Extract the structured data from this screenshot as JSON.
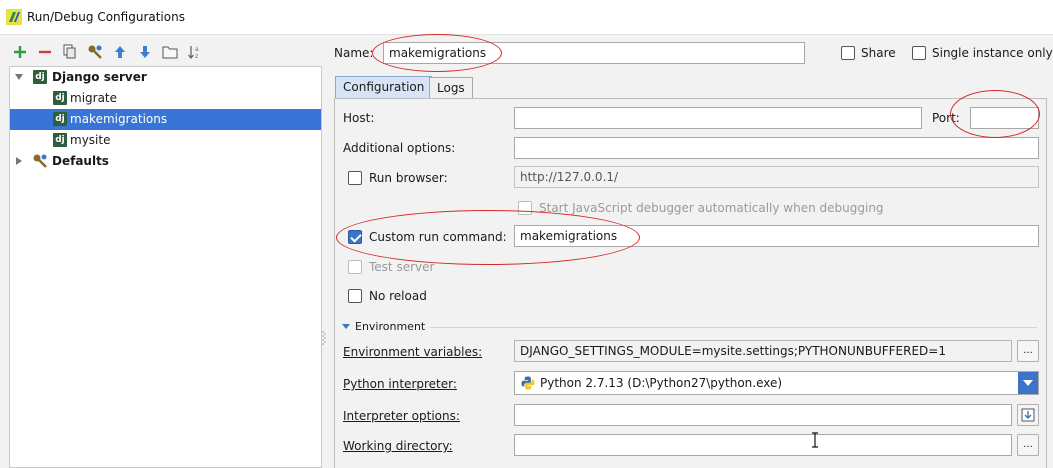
{
  "window": {
    "title": "Run/Debug Configurations"
  },
  "toolbar": {
    "buttons": [
      {
        "name": "add-icon",
        "glyph": "+"
      },
      {
        "name": "remove-icon",
        "glyph": "−"
      },
      {
        "name": "copy-icon"
      },
      {
        "name": "wrench-icon"
      },
      {
        "name": "move-up-icon"
      },
      {
        "name": "move-down-icon"
      },
      {
        "name": "folder-icon"
      },
      {
        "name": "sort-icon"
      }
    ]
  },
  "tree": {
    "group": "Django server",
    "items": [
      "migrate",
      "makemigrations",
      "mysite"
    ],
    "selected": "makemigrations",
    "defaults": "Defaults"
  },
  "header": {
    "name_label": "Name:",
    "name_value": "makemigrations",
    "share_label": "Share",
    "single_instance_label": "Single instance only"
  },
  "tabs": [
    "Configuration",
    "Logs"
  ],
  "config": {
    "host_label": "Host:",
    "host_value": "",
    "port_label": "Port:",
    "port_value": "",
    "additional_options_label": "Additional options:",
    "additional_options_value": "",
    "run_browser_label": "Run browser:",
    "run_browser_url": "http://127.0.0.1/",
    "js_debugger_label": "Start JavaScript debugger automatically when debugging",
    "custom_run_label": "Custom run command:",
    "custom_run_value": "makemigrations",
    "custom_run_checked": true,
    "test_server_label": "Test server",
    "no_reload_label": "No reload",
    "environment_section": "Environment",
    "env_vars_label": "Environment variables:",
    "env_vars_value": "DJANGO_SETTINGS_MODULE=mysite.settings;PYTHONUNBUFFERED=1",
    "python_interpreter_label": "Python interpreter:",
    "python_interpreter_value": "Python 2.7.13 (D:\\Python27\\python.exe)",
    "interpreter_options_label": "Interpreter options:",
    "interpreter_options_value": "",
    "working_dir_label": "Working directory:",
    "working_dir_value": "",
    "ellipsis": "..."
  },
  "colors": {
    "accent": "#3c74c9",
    "selection": "#3875d7",
    "annotation": "#d62828",
    "django": "#2f5e3c"
  }
}
